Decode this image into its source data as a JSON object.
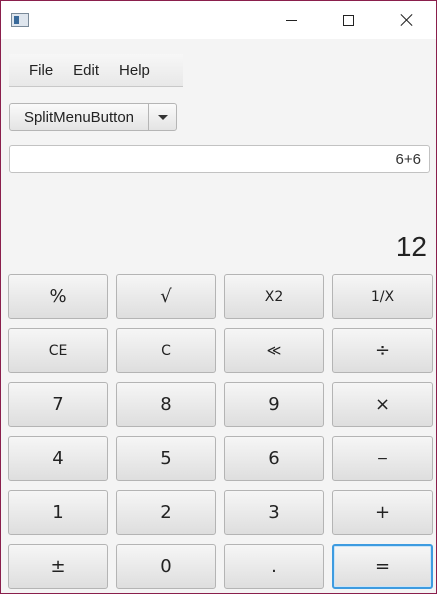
{
  "menubar": {
    "items": [
      "File",
      "Edit",
      "Help"
    ]
  },
  "split_button": {
    "label": "SplitMenuButton"
  },
  "display": {
    "expression": "6+6",
    "result": "12"
  },
  "keypad": {
    "rows": [
      [
        "%",
        "√",
        "X2",
        "1/X"
      ],
      [
        "CE",
        "C",
        "≪",
        "÷"
      ],
      [
        "7",
        "8",
        "9",
        "×"
      ],
      [
        "4",
        "5",
        "6",
        "−"
      ],
      [
        "1",
        "2",
        "3",
        "+"
      ],
      [
        "±",
        "0",
        ".",
        "="
      ]
    ]
  }
}
